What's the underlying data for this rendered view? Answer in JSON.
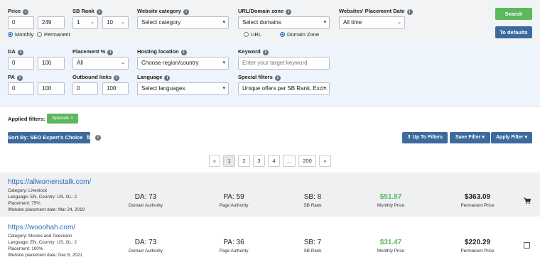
{
  "filters": {
    "price": {
      "label": "Price",
      "min": "0",
      "max": "249",
      "period_options": [
        "Monthly",
        "Permanent"
      ],
      "period_selected": "Monthly"
    },
    "sb_rank": {
      "label": "SB Rank",
      "min": "1",
      "max": "10"
    },
    "website_category": {
      "label": "Website category",
      "value": "Select category"
    },
    "url_zone": {
      "label": "URL/Domain zone",
      "value": "Select domains",
      "mode_options": [
        "URL",
        "Domain Zone"
      ],
      "mode_selected": "Domain Zone"
    },
    "placement_date": {
      "label": "Websites' Placement Date",
      "value": "All time"
    },
    "da": {
      "label": "DA",
      "min": "0",
      "max": "100"
    },
    "placement_pct": {
      "label": "Placement %",
      "value": "All"
    },
    "hosting_location": {
      "label": "Hosting location",
      "value": "Choose region/country"
    },
    "keyword": {
      "label": "Keyword",
      "placeholder": "Enter your target keyword"
    },
    "pa": {
      "label": "PA",
      "min": "0",
      "max": "100"
    },
    "outbound_links": {
      "label": "Outbound links",
      "min": "0",
      "max": "100"
    },
    "language": {
      "label": "Language",
      "value": "Select languages"
    },
    "special_filters": {
      "label": "Special filters",
      "value": "Unique offers per SB Rank, Excl..."
    }
  },
  "actions": {
    "search": "Search",
    "defaults": "To defaults"
  },
  "applied": {
    "label": "Applied filters:",
    "chip": "Specials ×"
  },
  "toolbar": {
    "sort": "Sort By: SEO Expert's Choice",
    "up": "Up To Filters",
    "save_filter": "Save Filter",
    "apply_filter": "Apply Filter"
  },
  "pagination": {
    "prev": "«",
    "pages": [
      "1",
      "2",
      "3",
      "4",
      "...",
      "200"
    ],
    "next": "»",
    "active": "1"
  },
  "results": [
    {
      "url": "https://allwomenstalk.com/",
      "category": "Category: Livestock",
      "language": "Language: EN, Country: US, OL: 2",
      "placement": "Placement: 75%",
      "date": "Website placement date: Mar 24, 2019",
      "da": "DA: 73",
      "da_caption": "Domain Authority",
      "pa": "PA: 59",
      "pa_caption": "Page Authority",
      "sb": "SB: 8",
      "sb_caption": "SB Rank",
      "monthly": "$51.87",
      "monthly_caption": "Monthly Price",
      "permanent": "$363.09",
      "permanent_caption": "Permanent Price"
    },
    {
      "url": "https://wooohah.com/",
      "category": "Category: Movies and Television",
      "language": "Language: EN, Country: US, OL: 2",
      "placement": "Placement: 100%",
      "date": "Website placement date: Dec 6, 2021",
      "da": "DA: 73",
      "da_caption": "Domain Authority",
      "pa": "PA: 36",
      "pa_caption": "Page Authority",
      "sb": "SB: 7",
      "sb_caption": "SB Rank",
      "monthly": "$31.47",
      "monthly_caption": "Monthly Price",
      "permanent": "$220.29",
      "permanent_caption": "Permanent Price"
    }
  ],
  "colors": {
    "accent_blue": "#3d6a9e",
    "green": "#5cb85c",
    "link": "#2a6db8"
  }
}
